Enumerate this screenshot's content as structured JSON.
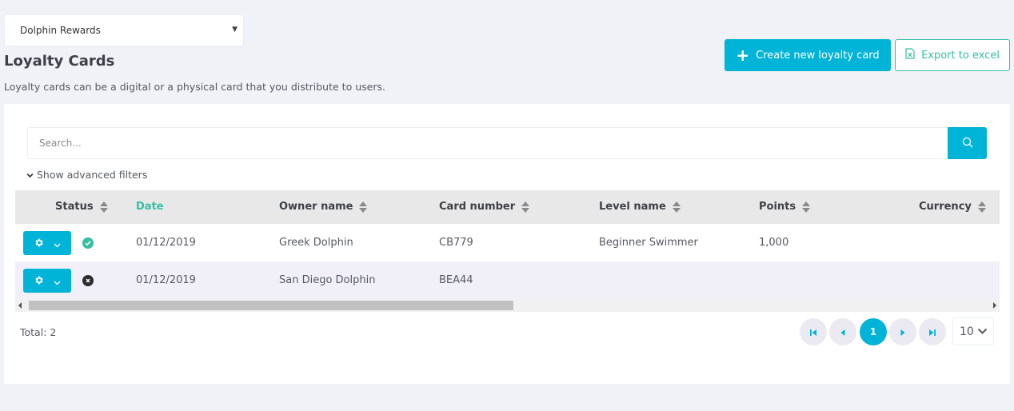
{
  "program_select": {
    "value": "Dolphin Rewards"
  },
  "page": {
    "title": "Loyalty Cards",
    "description": "Loyalty cards can be a digital or a physical card that you distribute to users."
  },
  "actions": {
    "create_label": "Create new loyalty card",
    "export_label": "Export to excel"
  },
  "search": {
    "placeholder": "Search..."
  },
  "filters": {
    "advanced_label": "Show advanced filters"
  },
  "table": {
    "columns": [
      "Status",
      "Date",
      "Owner name",
      "Card number",
      "Level name",
      "Points",
      "Currency"
    ],
    "rows": [
      {
        "status": "active",
        "date": "01/12/2019",
        "owner": "Greek Dolphin",
        "card_number": "CB779",
        "level": "Beginner Swimmer",
        "points": "1,000",
        "currency": ""
      },
      {
        "status": "inactive",
        "date": "01/12/2019",
        "owner": "San Diego Dolphin",
        "card_number": "BEA44",
        "level": "",
        "points": "",
        "currency": ""
      }
    ]
  },
  "footer": {
    "total": "Total: 2",
    "current_page": "1",
    "page_size": "10"
  },
  "colors": {
    "primary": "#00b4d8",
    "success": "#34bfa3",
    "header_bg": "#e8e8e8",
    "alt_row_bg": "#f1f0f9"
  },
  "icons": {
    "create": "plus-icon",
    "export": "excel-file-icon",
    "search": "search-icon",
    "filters": "chevron-down-icon",
    "row_actions": "gear-icon",
    "status_active": "check-circle-icon",
    "status_inactive": "x-circle-icon"
  }
}
